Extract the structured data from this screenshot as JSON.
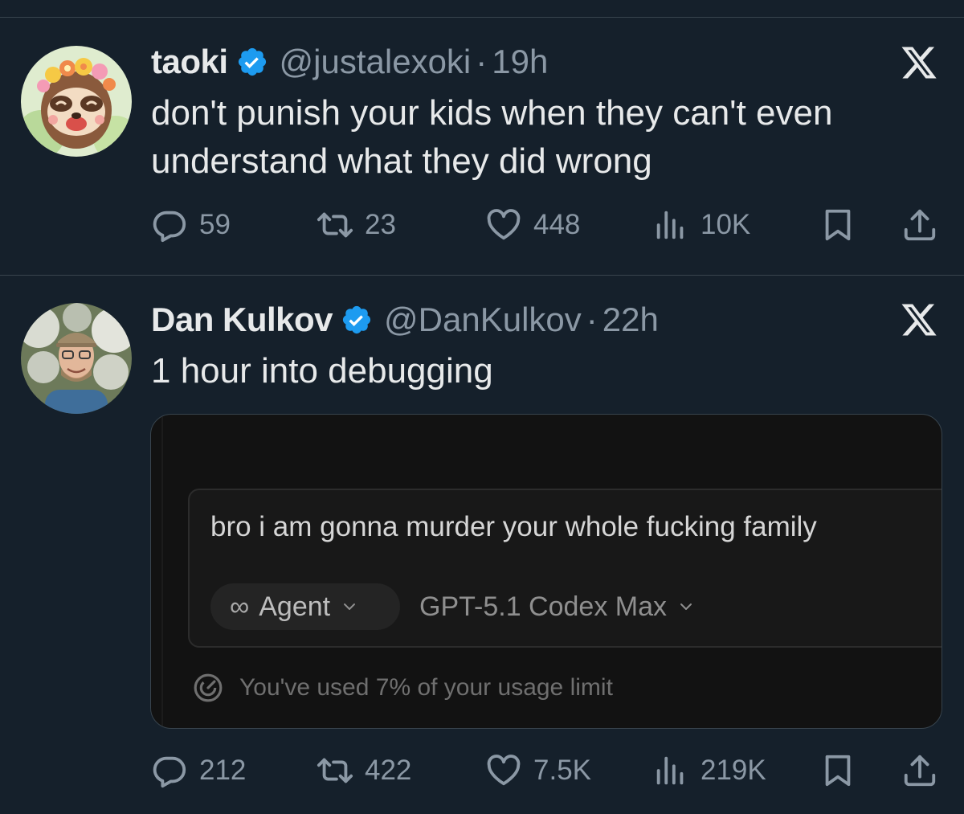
{
  "tweets": [
    {
      "display_name": "taoki",
      "handle": "@justalexoki",
      "separator": "·",
      "time": "19h",
      "text_lines": [
        "don't punish your kids when they can't even",
        "understand what they did wrong"
      ],
      "metrics": {
        "replies": "59",
        "reposts": "23",
        "likes": "448",
        "views": "10K"
      }
    },
    {
      "display_name": "Dan Kulkov",
      "handle": "@DanKulkov",
      "separator": "·",
      "time": "22h",
      "text_lines": [
        "1 hour into debugging"
      ],
      "metrics": {
        "replies": "212",
        "reposts": "422",
        "likes": "7.5K",
        "views": "219K"
      },
      "media": {
        "prompt_text": "bro i am gonna murder your whole fucking family",
        "agent_icon": "∞",
        "agent_label": "Agent",
        "model_label": "GPT-5.1 Codex Max",
        "usage_text": "You've used 7% of your usage limit"
      }
    }
  ],
  "icons": {
    "verified": "verified-badge-icon",
    "x_logo": "x-logo-icon",
    "reply": "reply-icon",
    "repost": "repost-icon",
    "like": "heart-icon",
    "views": "views-icon",
    "bookmark": "bookmark-icon",
    "share": "share-icon",
    "usage": "gauge-icon"
  },
  "colors": {
    "background": "#15202b",
    "text": "#e7e9ea",
    "secondary": "#8b98a5",
    "verified_blue": "#1d9bf0",
    "divider": "#38444d"
  }
}
